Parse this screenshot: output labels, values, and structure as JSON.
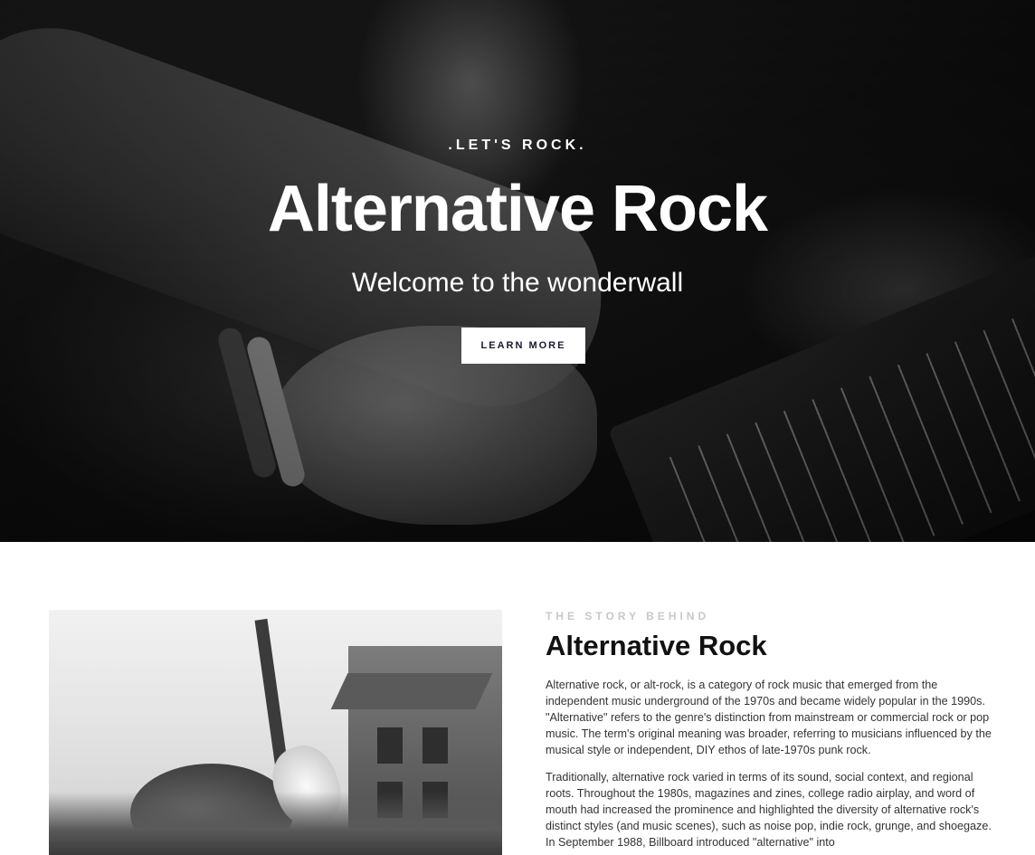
{
  "hero": {
    "eyebrow": ".LET'S ROCK.",
    "title": "Alternative Rock",
    "subtitle": "Welcome to the wonderwall",
    "cta_label": "LEARN MORE"
  },
  "story": {
    "eyebrow": "THE STORY BEHIND",
    "title": "Alternative Rock",
    "paragraphs": [
      "Alternative rock, or alt-rock, is a category of rock music that emerged from the independent music underground of the 1970s and became widely popular in the 1990s. \"Alternative\" refers to the genre's distinction from mainstream or commercial rock or pop music. The term's original meaning was broader, referring to musicians influenced by the musical style or independent, DIY ethos of late-1970s punk rock.",
      "Traditionally, alternative rock varied in terms of its sound, social context, and regional roots. Throughout the 1980s, magazines and zines, college radio airplay, and word of mouth had increased the prominence and highlighted the diversity of alternative rock's distinct styles (and music scenes), such as noise pop, indie rock, grunge, and shoegaze. In September 1988, Billboard introduced \"alternative\" into"
    ]
  },
  "colors": {
    "cta_text": "#1a1a2e",
    "eyebrow_muted": "#c8c8c8",
    "title_dark": "#111111"
  }
}
